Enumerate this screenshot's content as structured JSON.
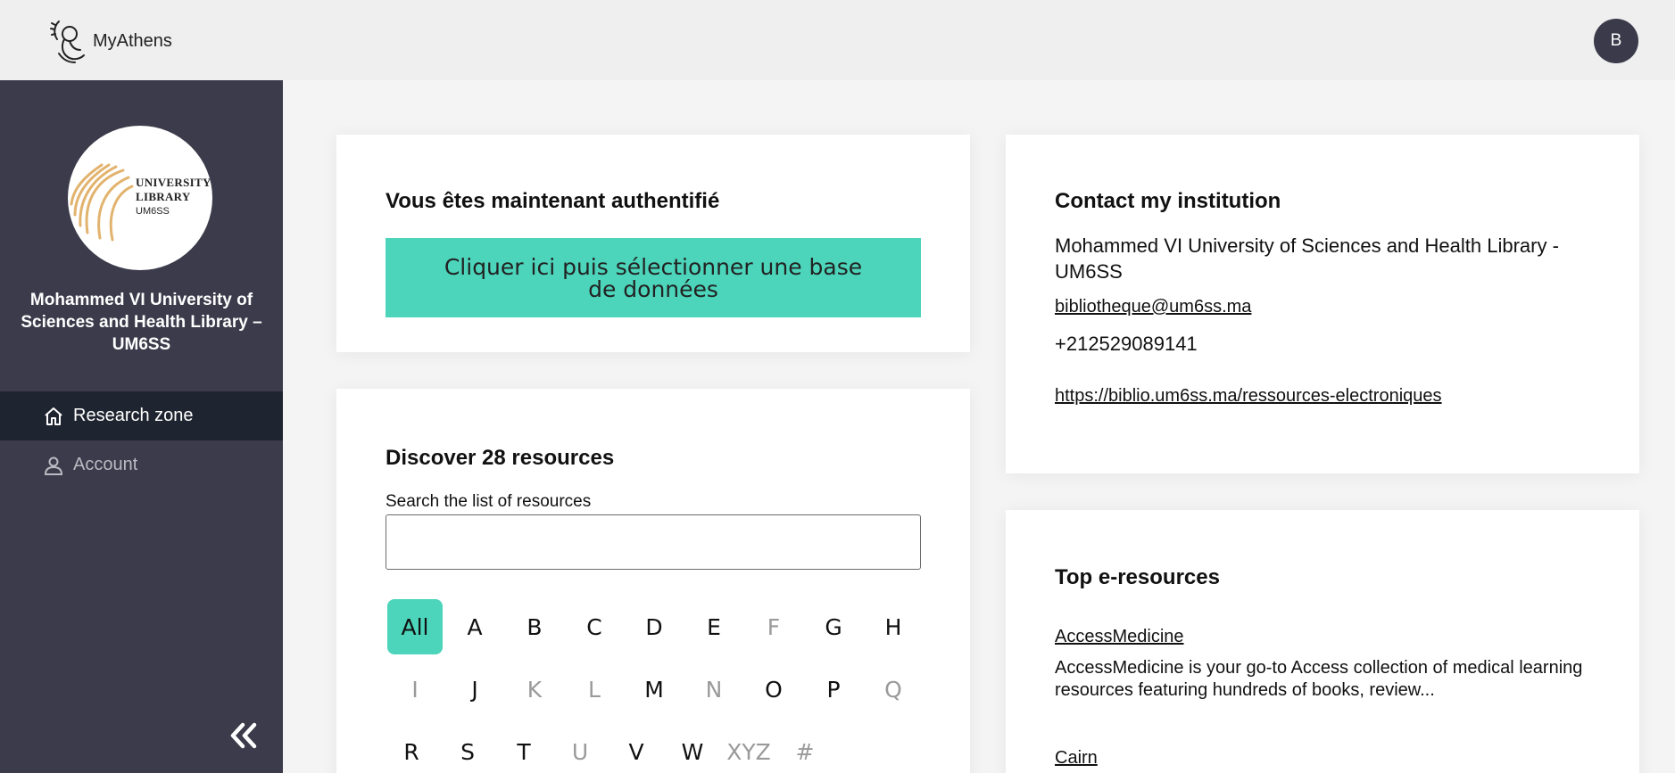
{
  "header": {
    "brand": "MyAthens",
    "avatar_initial": "B"
  },
  "sidebar": {
    "logo": {
      "line1": "UNIVERSITY",
      "line2": "LIBRARY",
      "line3": "UM6SS"
    },
    "institution_name": "Mohammed VI University of Sciences and Health Library – UM6SS",
    "nav": [
      {
        "label": "Research zone",
        "active": true
      },
      {
        "label": "Account",
        "active": false
      }
    ]
  },
  "auth_card": {
    "title": "Vous êtes maintenant authentifié",
    "button_label": "Cliquer ici puis sélectionner une base de données"
  },
  "resources_card": {
    "title": "Discover 28 resources",
    "search_label": "Search the list of resources",
    "search_value": "",
    "letters": [
      {
        "label": "All",
        "enabled": true,
        "active": true
      },
      {
        "label": "A",
        "enabled": true
      },
      {
        "label": "B",
        "enabled": true
      },
      {
        "label": "C",
        "enabled": true
      },
      {
        "label": "D",
        "enabled": true
      },
      {
        "label": "E",
        "enabled": true
      },
      {
        "label": "F",
        "enabled": false
      },
      {
        "label": "G",
        "enabled": true
      },
      {
        "label": "H",
        "enabled": true
      },
      {
        "label": "I",
        "enabled": false
      },
      {
        "label": "J",
        "enabled": true
      },
      {
        "label": "K",
        "enabled": false
      },
      {
        "label": "L",
        "enabled": false
      },
      {
        "label": "M",
        "enabled": true
      },
      {
        "label": "N",
        "enabled": false
      },
      {
        "label": "O",
        "enabled": true
      },
      {
        "label": "P",
        "enabled": true
      },
      {
        "label": "Q",
        "enabled": false
      },
      {
        "label": "R",
        "enabled": true
      },
      {
        "label": "S",
        "enabled": true
      },
      {
        "label": "T",
        "enabled": true
      },
      {
        "label": "U",
        "enabled": false
      },
      {
        "label": "V",
        "enabled": true
      },
      {
        "label": "W",
        "enabled": true
      },
      {
        "label": "XYZ",
        "enabled": false
      },
      {
        "label": "#",
        "enabled": false
      }
    ]
  },
  "contact_card": {
    "title": "Contact my institution",
    "name": "Mohammed VI University of Sciences and Health Library - UM6SS",
    "email": "bibliotheque@um6ss.ma",
    "phone": "+212529089141",
    "website": "https://biblio.um6ss.ma/ressources-electroniques"
  },
  "top_card": {
    "title": "Top e-resources",
    "items": [
      {
        "name": "AccessMedicine",
        "description": "AccessMedicine is your go-to Access collection of medical learning resources featuring hundreds of books, review..."
      },
      {
        "name": "Cairn",
        "description": ""
      }
    ]
  },
  "colors": {
    "accent": "#4cd5bb",
    "sidebar_bg": "#3c3b4b",
    "sidebar_active": "#1f2530",
    "header_bg": "#efefef"
  }
}
